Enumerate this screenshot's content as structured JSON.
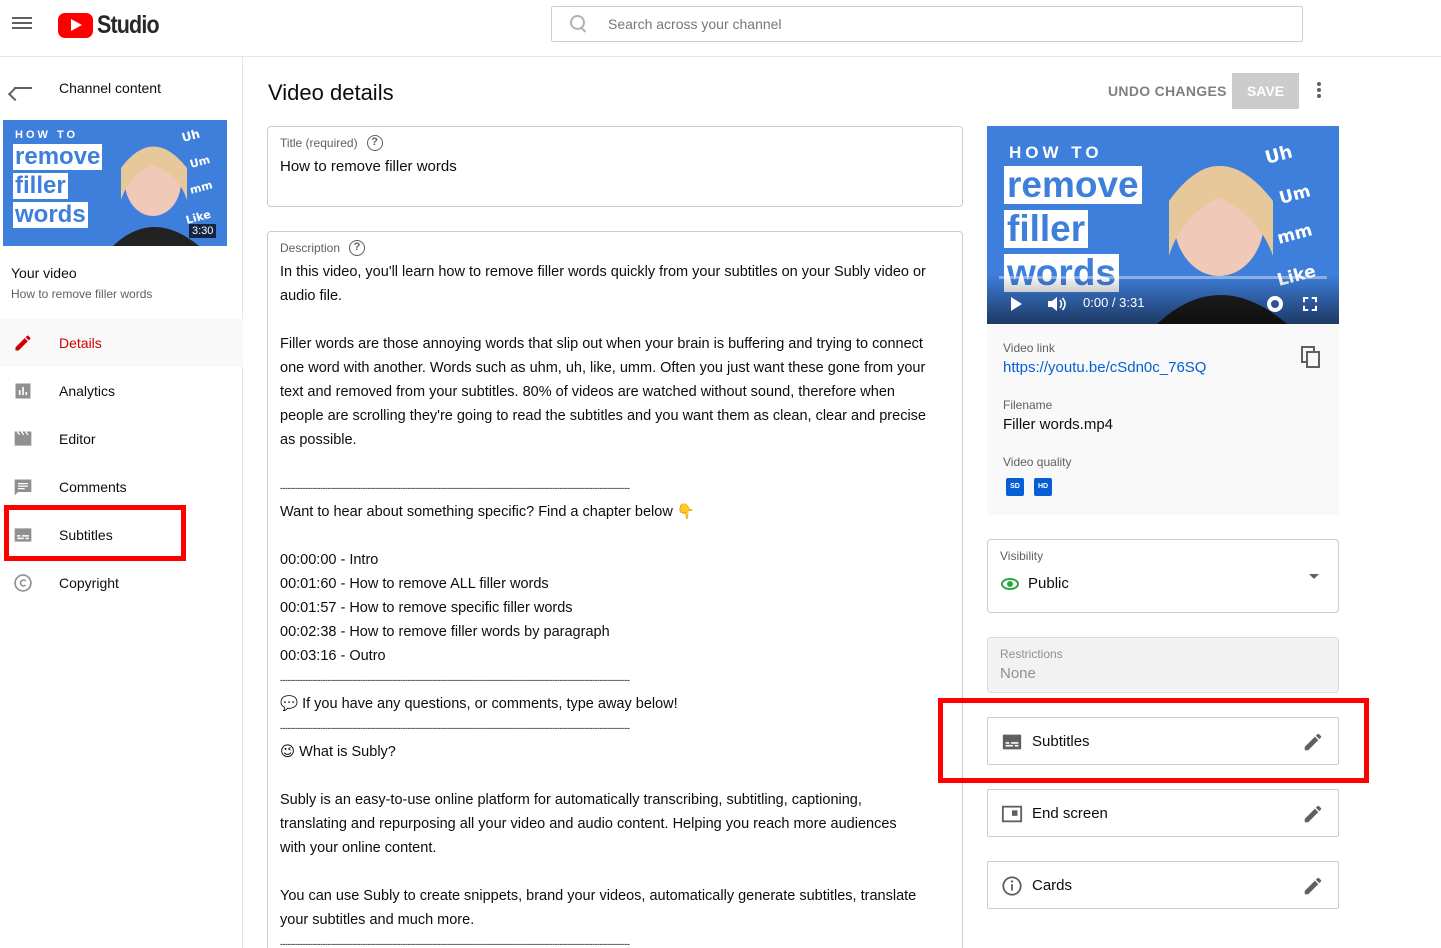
{
  "app": {
    "logo_text": "Studio",
    "search_placeholder": "Search across your channel"
  },
  "sidebar": {
    "back_label": "Channel content",
    "thumbnail": {
      "line1": "HOW TO",
      "line2": "remove",
      "line3": "filler",
      "line4": "words",
      "duration": "3:30"
    },
    "your_video_label": "Your video",
    "video_title": "How to remove filler words",
    "items": [
      {
        "label": "Details",
        "icon": "pencil-icon",
        "active": true
      },
      {
        "label": "Analytics",
        "icon": "analytics-icon",
        "active": false
      },
      {
        "label": "Editor",
        "icon": "clapperboard-icon",
        "active": false
      },
      {
        "label": "Comments",
        "icon": "comment-icon",
        "active": false
      },
      {
        "label": "Subtitles",
        "icon": "subtitles-icon",
        "active": false
      },
      {
        "label": "Copyright",
        "icon": "copyright-icon",
        "active": false
      }
    ]
  },
  "header": {
    "title": "Video details",
    "undo_label": "UNDO CHANGES",
    "save_label": "SAVE"
  },
  "title_field": {
    "label": "Title (required)",
    "value": "How to remove filler words"
  },
  "description": {
    "label": "Description",
    "lines": {
      "p1a": "In this video, you'll learn how to remove filler words quickly from your subtitles on your Subly video or",
      "p1b": "audio file.",
      "p2a": "Filler words are those annoying words that slip out when your brain is buffering and trying to connect",
      "p2b": "one word with another.  Words such as uhm, uh, like, umm.  Often you just want these gone from your",
      "p2c": "text and removed from your subtitles.  80% of videos are watched without sound, therefore when",
      "p2d": "people are scrolling they're going to read the subtitles and you want them as clean, clear and precise",
      "p2e": "as possible.",
      "dashes": "--------------------------------------------------------------------------------------------------------------------------------------------",
      "chapter_intro": "Want to hear about something specific? Find a chapter below 👇",
      "ch1": "00:00:00 - Intro",
      "ch2": "00:01:60 - How to remove ALL filler words",
      "ch3": "00:01:57 - How to remove specific filler words",
      "ch4": "00:02:38 - How to remove filler words by paragraph",
      "ch5": "00:03:16 - Outro",
      "questions": "💬 If you have any questions, or comments, type away below!",
      "what_is": "😉 What is Subly?",
      "p3a": "Subly is an easy-to-use online platform for automatically transcribing, subtitling, captioning,",
      "p3b": "translating and repurposing all your video and audio content.  Helping you reach more audiences",
      "p3c": "with your online content.",
      "p4a": "You can use Subly to create snippets, brand your videos, automatically generate subtitles, translate",
      "p4b": "your subtitles and much more."
    }
  },
  "video_card": {
    "player": {
      "line1": "HOW TO",
      "line2": "remove",
      "line3": "filler",
      "line4": "words",
      "time": "0:00 / 3:31"
    },
    "link_label": "Video link",
    "link_value": "https://youtu.be/cSdn0c_76SQ",
    "filename_label": "Filename",
    "filename_value": "Filler words.mp4",
    "quality_label": "Video quality",
    "quality_badges": [
      "SD",
      "HD"
    ]
  },
  "visibility": {
    "label": "Visibility",
    "value": "Public"
  },
  "restrictions": {
    "label": "Restrictions",
    "value": "None"
  },
  "options": [
    {
      "label": "Subtitles",
      "icon": "subtitles-icon"
    },
    {
      "label": "End screen",
      "icon": "end-screen-icon"
    },
    {
      "label": "Cards",
      "icon": "info-icon"
    }
  ],
  "colors": {
    "youtube_red": "#ff0000",
    "active_nav": "#cc0000",
    "link_blue": "#065fd4",
    "visibility_green": "#2ba640",
    "annotation_red": "#ff0000"
  }
}
